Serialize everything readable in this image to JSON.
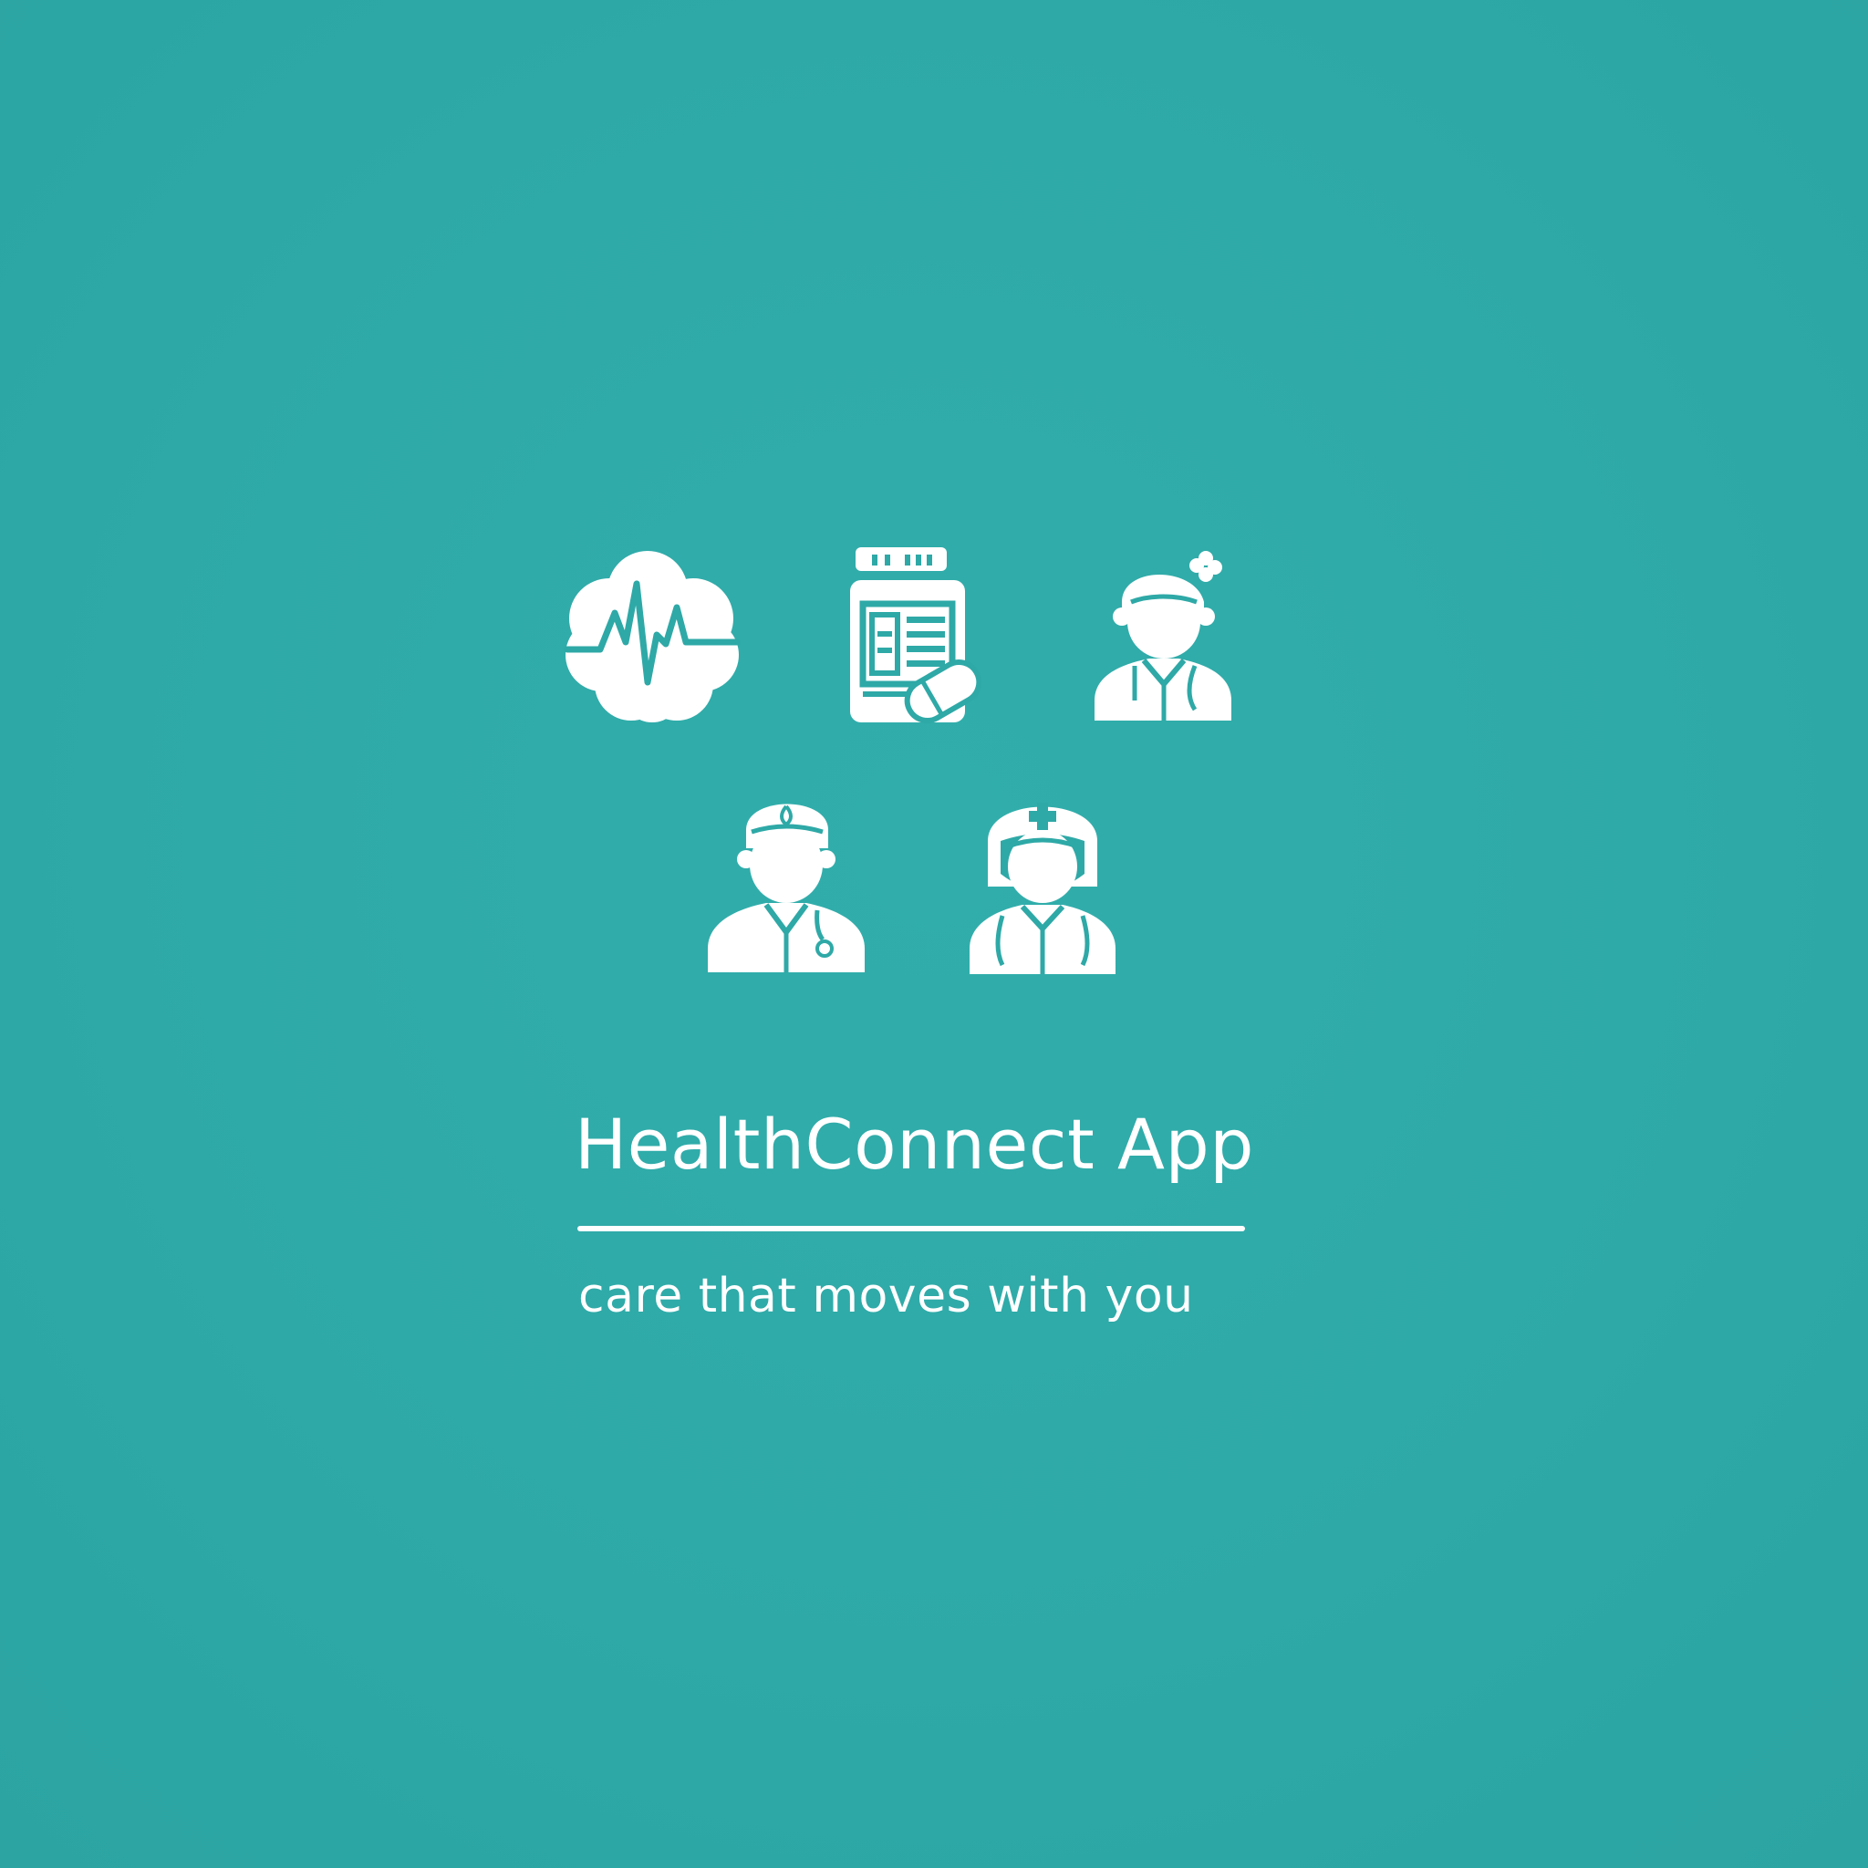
{
  "app": {
    "title": "HealthConnect App",
    "tagline": "care that moves with you"
  },
  "icons": [
    "heartbeat-cloud-icon",
    "mobile-health-record-icon",
    "patient-icon",
    "doctor-icon",
    "nurse-icon"
  ],
  "colors": {
    "background": "#2ea9a7",
    "foreground": "#ffffff"
  }
}
